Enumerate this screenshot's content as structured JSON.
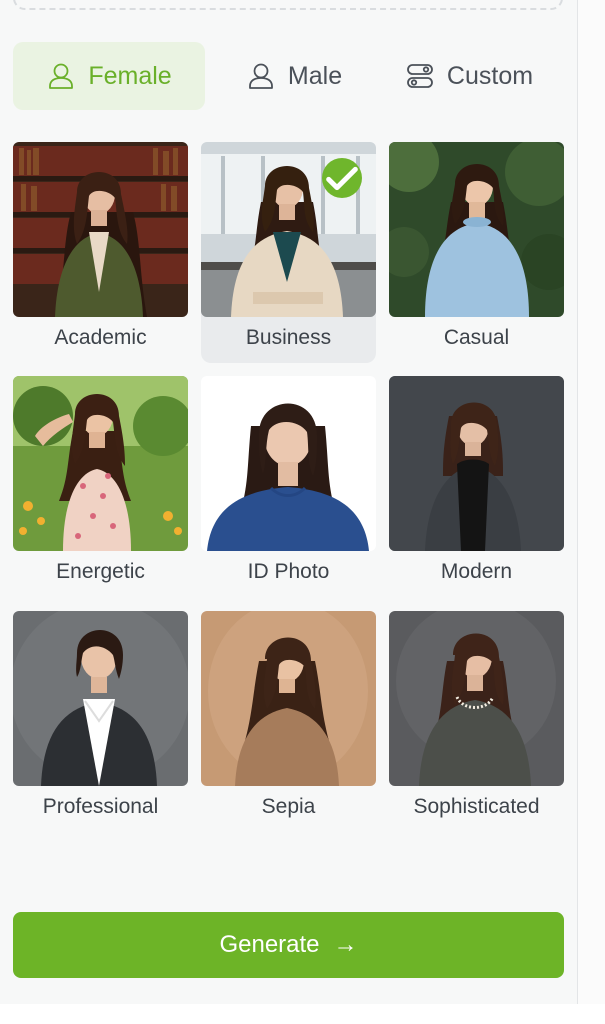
{
  "gender_tabs": [
    {
      "label": "Female",
      "icon": "person-icon",
      "active": true
    },
    {
      "label": "Male",
      "icon": "person-icon",
      "active": false
    },
    {
      "label": "Custom",
      "icon": "toggle-settings-icon",
      "active": false
    }
  ],
  "styles": [
    {
      "label": "Academic",
      "selected": false
    },
    {
      "label": "Business",
      "selected": true
    },
    {
      "label": "Casual",
      "selected": false
    },
    {
      "label": "Energetic",
      "selected": false
    },
    {
      "label": "ID Photo",
      "selected": false
    },
    {
      "label": "Modern",
      "selected": false
    },
    {
      "label": "Professional",
      "selected": false
    },
    {
      "label": "Sepia",
      "selected": false
    },
    {
      "label": "Sophisticated",
      "selected": false
    }
  ],
  "generate": {
    "label": "Generate",
    "arrow": "→"
  },
  "colors": {
    "accent": "#6db427",
    "active_tab_bg": "#eaf3e2",
    "selected_card_bg": "#e9ebed"
  }
}
